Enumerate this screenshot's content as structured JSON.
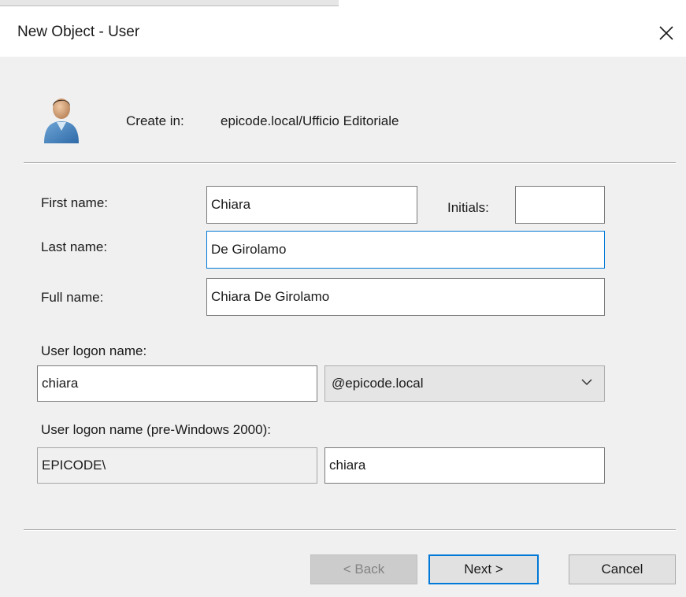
{
  "window": {
    "title": "New Object - User",
    "close_icon": "close-icon"
  },
  "header": {
    "icon": "user-icon",
    "create_in_label": "Create in:",
    "create_in_path": "epicode.local/Ufficio Editoriale"
  },
  "form": {
    "first_name_label": "First name:",
    "first_name_value": "Chiara",
    "initials_label": "Initials:",
    "initials_value": "",
    "last_name_label": "Last name:",
    "last_name_value": "De Girolamo",
    "full_name_label": "Full name:",
    "full_name_value": "Chiara De Girolamo",
    "logon_name_label": "User logon name:",
    "logon_name_value": "chiara",
    "domain_selected": "@epicode.local",
    "pre2000_label": "User logon name (pre-Windows 2000):",
    "pre2000_domain": "EPICODE\\",
    "pre2000_value": "chiara"
  },
  "buttons": {
    "back": "< Back",
    "next": "Next >",
    "cancel": "Cancel"
  },
  "colors": {
    "focus_border": "#0078d7",
    "dialog_background": "#f0f0f0"
  }
}
